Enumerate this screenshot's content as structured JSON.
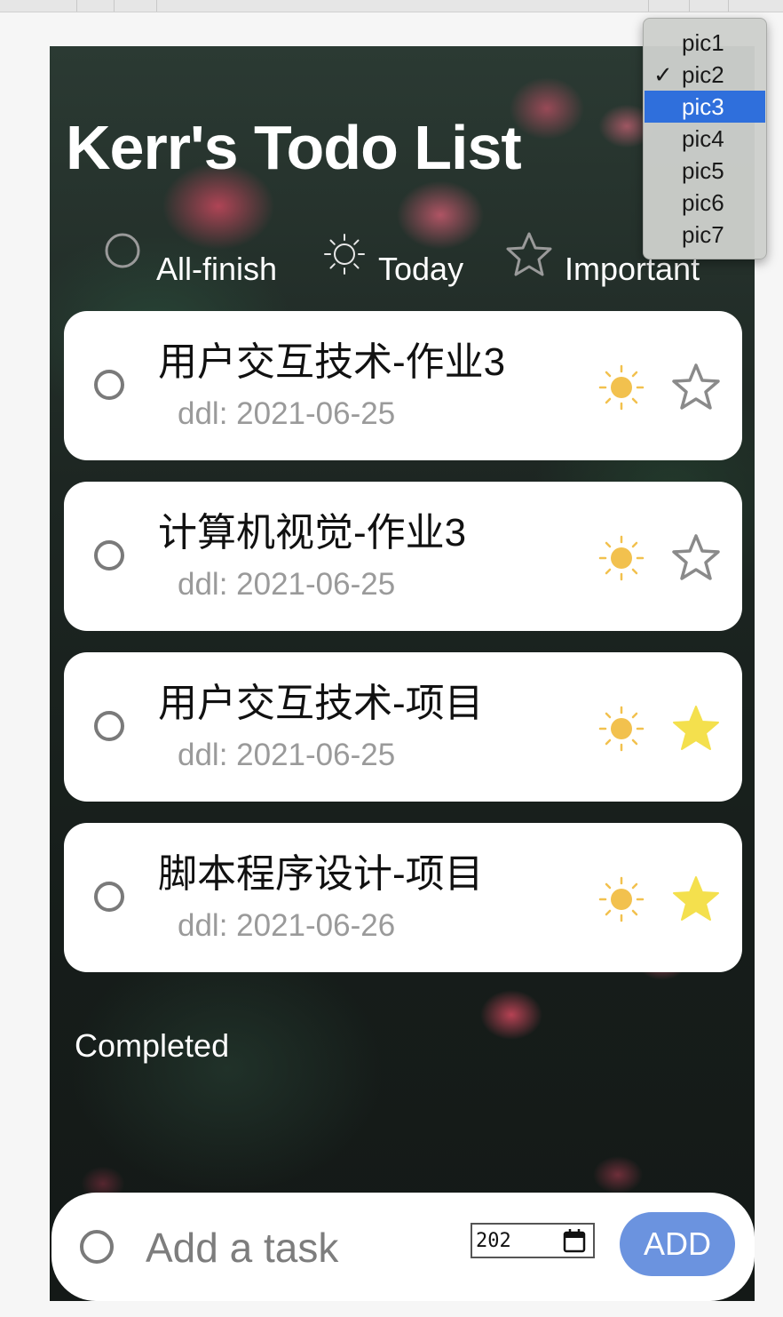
{
  "app": {
    "title": "Kerr's Todo List"
  },
  "filters": [
    {
      "label": "All-finish",
      "icon": "circle-icon"
    },
    {
      "label": "Today",
      "icon": "sun-icon"
    },
    {
      "label": "Important",
      "icon": "star-icon"
    }
  ],
  "tasks": [
    {
      "name": "用户交互技术-作业3",
      "ddl": "ddl: 2021-06-25",
      "today": true,
      "important": false
    },
    {
      "name": "计算机视觉-作业3",
      "ddl": "ddl: 2021-06-25",
      "today": true,
      "important": false
    },
    {
      "name": "用户交互技术-项目",
      "ddl": "ddl: 2021-06-25",
      "today": true,
      "important": true
    },
    {
      "name": "脚本程序设计-项目",
      "ddl": "ddl: 2021-06-26",
      "today": true,
      "important": true
    }
  ],
  "completed_label": "Completed",
  "add_bar": {
    "placeholder": "Add a task",
    "date_value": "202",
    "add_label": "ADD"
  },
  "background_menu": {
    "options": [
      "pic1",
      "pic2",
      "pic3",
      "pic4",
      "pic5",
      "pic6",
      "pic7"
    ],
    "checked": "pic2",
    "highlighted": "pic3"
  },
  "colors": {
    "sun": "#f2c14e",
    "star_filled": "#f4e04d",
    "star_empty": "#8a8a8a",
    "add_button": "#6b93df",
    "menu_highlight": "#2f6fdc"
  }
}
